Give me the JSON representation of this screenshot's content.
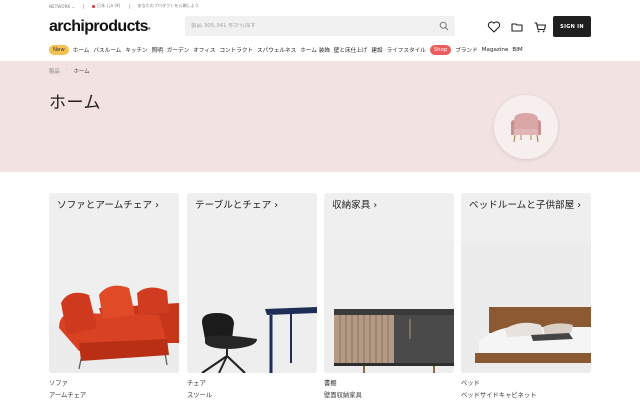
{
  "topbar": {
    "network": "NETWORK",
    "chevron": "⌄",
    "country": "日本 | ja (¥)",
    "promo": "あなたのプロダクトを公開しよう"
  },
  "header": {
    "logo": "archiproducts",
    "logo_mark": "®",
    "search_placeholder": "製品 305,341 件から探す",
    "signin_label": "SIGN IN"
  },
  "nav": {
    "new_badge": "New",
    "items": [
      "ホーム",
      "バスルーム",
      "キッチン",
      "照明",
      "ガーデン",
      "オフィス",
      "コントラクト",
      "スパウェルネス",
      "ホーム 装飾",
      "壁と床仕上げ",
      "建設",
      "ライフスタイル"
    ],
    "shop_badge": "Shop",
    "extra": [
      "ブランド",
      "Magazine",
      "BIM"
    ]
  },
  "breadcrumb": [
    "製品",
    "ホーム"
  ],
  "page_title": "ホーム",
  "cards": [
    {
      "title": "ソファとアームチェア ›",
      "links": [
        "ソファ",
        "アームチェア"
      ]
    },
    {
      "title": "テーブルとチェア ›",
      "links": [
        "チェア",
        "スツール"
      ]
    },
    {
      "title": "収納家具 ›",
      "links": [
        "書棚",
        "壁面収納家具"
      ]
    },
    {
      "title": "ベッドルームと子供部屋 ›",
      "links": [
        "ベッド",
        "ベッドサイドキャビネット"
      ]
    }
  ],
  "colors": {
    "hero_bg": "#f2e3e2",
    "new_badge": "#f4c152",
    "shop_badge": "#ef5b5b",
    "signin_bg": "#1f1f1f"
  },
  "icons": [
    "search-icon",
    "heart-icon",
    "folder-icon",
    "cart-icon",
    "chair-icon"
  ]
}
